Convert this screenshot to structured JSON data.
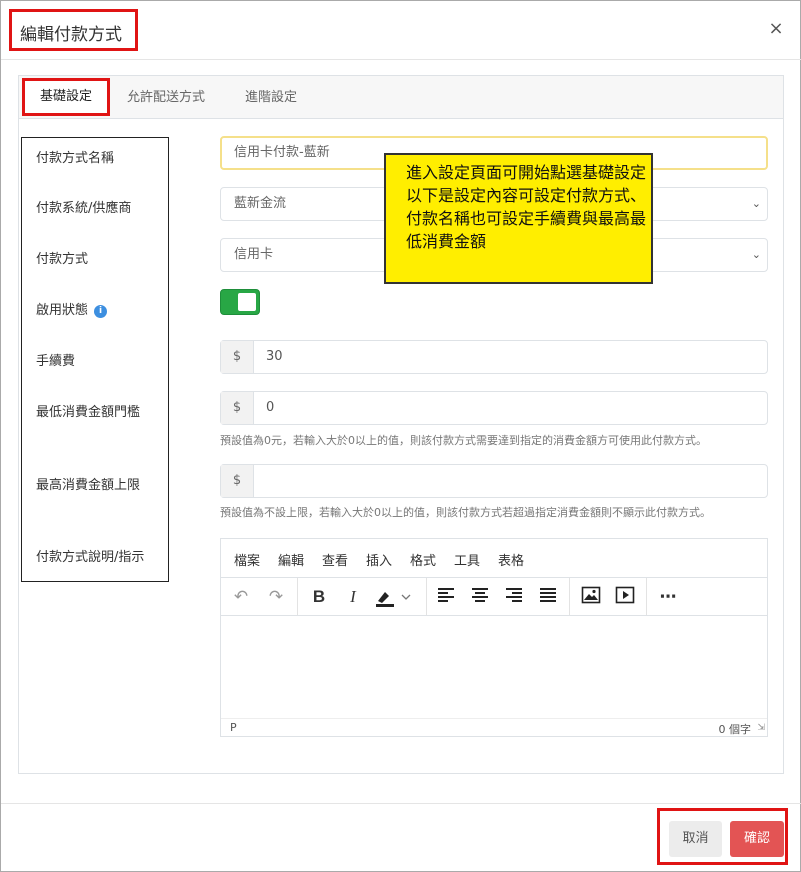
{
  "modal": {
    "title": "編輯付款方式",
    "close_symbol": "×"
  },
  "tabs": [
    {
      "label": "基礎設定"
    },
    {
      "label": "允許配送方式"
    },
    {
      "label": "進階設定"
    }
  ],
  "form": {
    "labels": {
      "name": "付款方式名稱",
      "provider": "付款系統/供應商",
      "method": "付款方式",
      "status": "啟用狀態",
      "fee": "手續費",
      "min_amount": "最低消費金額門檻",
      "max_amount": "最高消費金額上限",
      "description": "付款方式說明/指示"
    },
    "name_value": "信用卡付款-藍新",
    "provider_value": "藍新金流",
    "method_value": "信用卡",
    "status_enabled": true,
    "currency_symbol": "$",
    "fee_value": "30",
    "min_value": "0",
    "max_value": "",
    "min_hint": "預設值為0元，若輸入大於0以上的值，則該付款方式需要達到指定的消費金額方可使用此付款方式。",
    "max_hint": "預設值為不設上限，若輸入大於0以上的值，則該付款方式若超過指定消費金額則不顯示此付款方式。"
  },
  "editor": {
    "menu": [
      "檔案",
      "編輯",
      "查看",
      "插入",
      "格式",
      "工具",
      "表格"
    ],
    "status_path": "P",
    "word_count": "0 個字"
  },
  "callout": {
    "text": "進入設定頁面可開始點選基礎設定以下是設定內容可設定付款方式、付款名稱也可設定手續費與最高最低消費金額"
  },
  "footer": {
    "cancel_label": "取消",
    "confirm_label": "確認"
  },
  "colors": {
    "highlight_border": "#e01414",
    "toggle_on": "#28a745",
    "confirm_button": "#e35454",
    "callout_bg": "#ffee00"
  }
}
